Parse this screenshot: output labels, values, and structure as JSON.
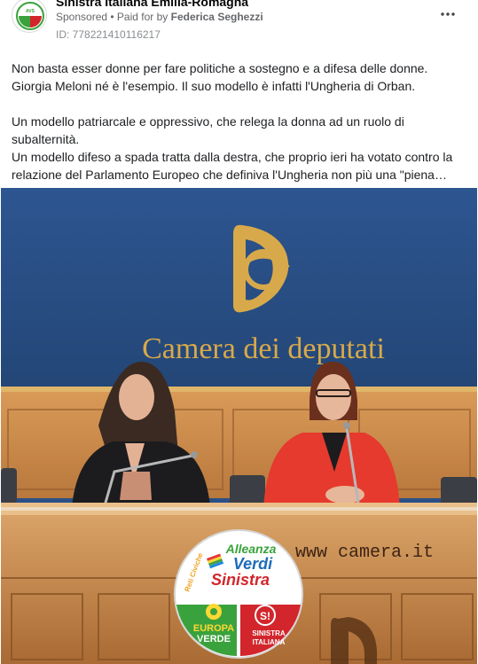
{
  "post": {
    "page_name": "Sinistra Italiana Emilia-Romagna",
    "sponsored_label": "Sponsored",
    "separator": " • ",
    "paid_for_prefix": "Paid for by ",
    "paid_for_name": "Federica Seghezzi",
    "ad_id": "ID: 778221410116217",
    "more_icon": "more-dots-icon"
  },
  "body": {
    "line1": "Non basta esser donne per fare politiche a sostegno e a difesa delle donne.",
    "line2": "Giorgia Meloni né è l'esempio. Il suo modello è infatti l'Ungheria di Orban.",
    "line3": "Un modello patriarcale e oppressivo, che relega la donna ad un ruolo di",
    "line4": "subalternità.",
    "line5": "Un modello difeso a spada tratta dalla destra, che proprio ieri ha votato contro la",
    "line6": "relazione del Parlamento Europeo che definiva l'Ungheria non più una \"piena…"
  },
  "image": {
    "wall_sign": "Camera dei deputati",
    "desk_text": "www camera.it",
    "logo": {
      "top_line1": "Alleanza",
      "top_line2": "Verdi",
      "top_line3": "Sinistra",
      "side_text": "Reti Civiche",
      "left_line1": "EUROPA",
      "left_line2": "VERDE",
      "right_line1": "SINISTRA",
      "right_line2": "ITALIANA"
    }
  },
  "colors": {
    "wall_blue": "#2a4f86",
    "wood": "#c98a4b",
    "gold": "#d8a94a",
    "logo_green": "#3aa23c",
    "logo_red": "#d2262c"
  }
}
